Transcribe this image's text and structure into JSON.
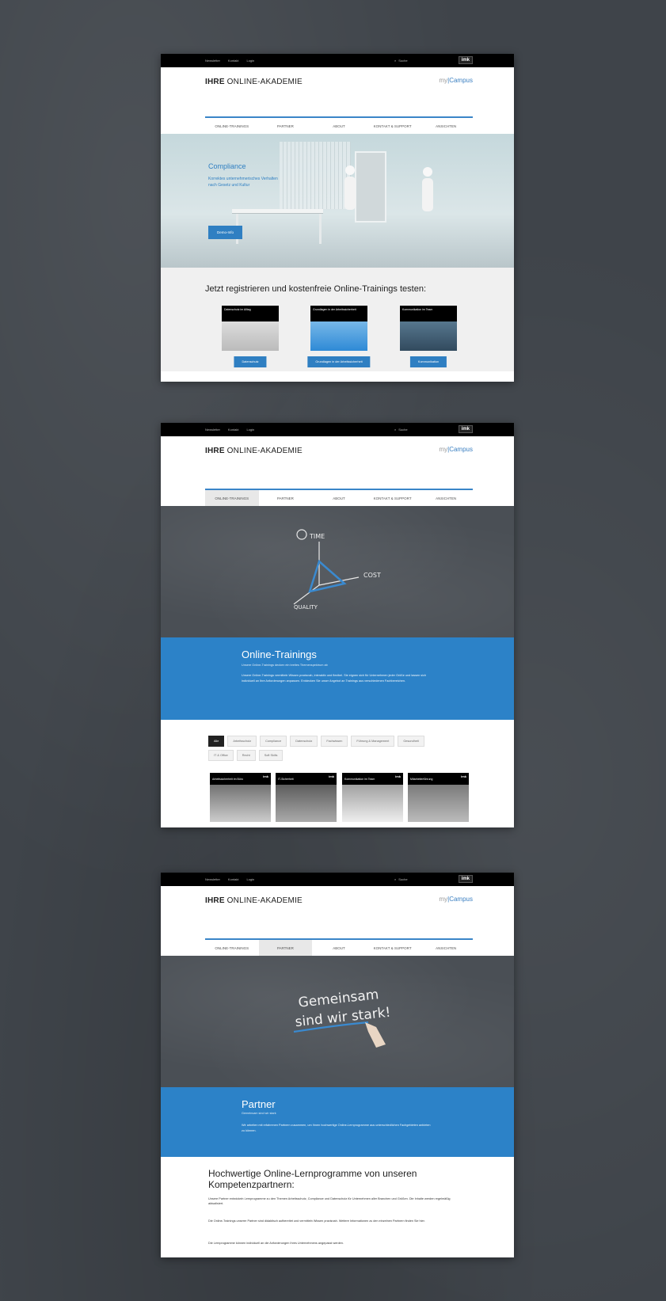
{
  "topbar": {
    "links": [
      "Newsletter",
      "Kontakt",
      "Login"
    ],
    "search": "Suche",
    "brand": "imk"
  },
  "header": {
    "logo_bold": "IHRE",
    "logo_rest": " ONLINE-AKADEMIE",
    "campus_prefix": "my",
    "campus_name": "Campus"
  },
  "nav": [
    "ONLINE-TRAININGS",
    "PARTNER",
    "ABOUT",
    "KONTAKT & SUPPORT",
    "ANSICHTEN"
  ],
  "nav_blur": [
    "ONLINE-TRAININGS",
    "PARTNER",
    "ABOUT",
    "KONTAKT & SUPPORT",
    "ANSICHTEN"
  ],
  "page1": {
    "hero_title": "Compliance",
    "hero_sub": "Korrektes unternehmerisches Verhalten nach Gesetz und Kultur",
    "hero_btn": "Demo-Info",
    "register_heading": "Jetzt registrieren und kostenfreie Online-Trainings testen:",
    "courses": [
      {
        "cap": "Datenschutz im Alltag",
        "btn": "Datenschutz"
      },
      {
        "cap": "Grundlagen in der Arbeitssicherheit",
        "btn": "Grundlagen in der Arbeitssicherheit"
      },
      {
        "cap": "Kommunikation im Team",
        "btn": "Kommunikation"
      }
    ]
  },
  "page2": {
    "chalk_words": [
      "TIME",
      "COST",
      "QUALITY"
    ],
    "title": "Online-Trainings",
    "subtitle": "Unsere Online-Trainings decken ein breites Themenspektrum ab",
    "body": "Unsere Online-Trainings vermitteln Wissen praxisnah, interaktiv und flexibel. Sie eignen sich für Unternehmen jeder Größe und lassen sich individuell an Ihre Anforderungen anpassen. Entdecken Sie unser Angebot an Trainings aus verschiedenen Fachbereichen.",
    "filters": [
      "Alle",
      "Arbeitsschutz",
      "Compliance",
      "Datenschutz",
      "Fachwissen",
      "Führung & Management",
      "Gesundheit",
      "IT & Office",
      "Recht",
      "Soft Skills"
    ],
    "tiles": [
      "Arbeitssicherheit im Büro",
      "IT-Sicherheit",
      "Kommunikation im Team",
      "Mitarbeiterführung"
    ]
  },
  "page3": {
    "chalk_line1": "Gemeinsam",
    "chalk_line2": "sind wir stark!",
    "title": "Partner",
    "subtitle": "Gemeinsam sind wir stark",
    "body": "Wir arbeiten mit erfahrenen Partnern zusammen, um Ihnen hochwertige Online-Lernprogramme aus unterschiedlichen Fachgebieten anbieten zu können.",
    "heading": "Hochwertige Online-Lernprogramme von unseren Kompetenzpartnern:",
    "paras": [
      "Unsere Partner entwickeln Lernprogramme zu den Themen Arbeitsschutz, Compliance und Datenschutz für Unternehmen aller Branchen und Größen. Die Inhalte werden regelmäßig aktualisiert.",
      "Die Online-Trainings unserer Partner sind didaktisch aufbereitet und vermitteln Wissen praxisnah. Weitere Informationen zu den einzelnen Partnern finden Sie hier.",
      "Die Lernprogramme können individuell an die Anforderungen Ihres Unternehmens angepasst werden."
    ]
  },
  "colors": {
    "accent": "#2c82c8",
    "topbar": "#000000",
    "chalk": "#4a4f55"
  }
}
